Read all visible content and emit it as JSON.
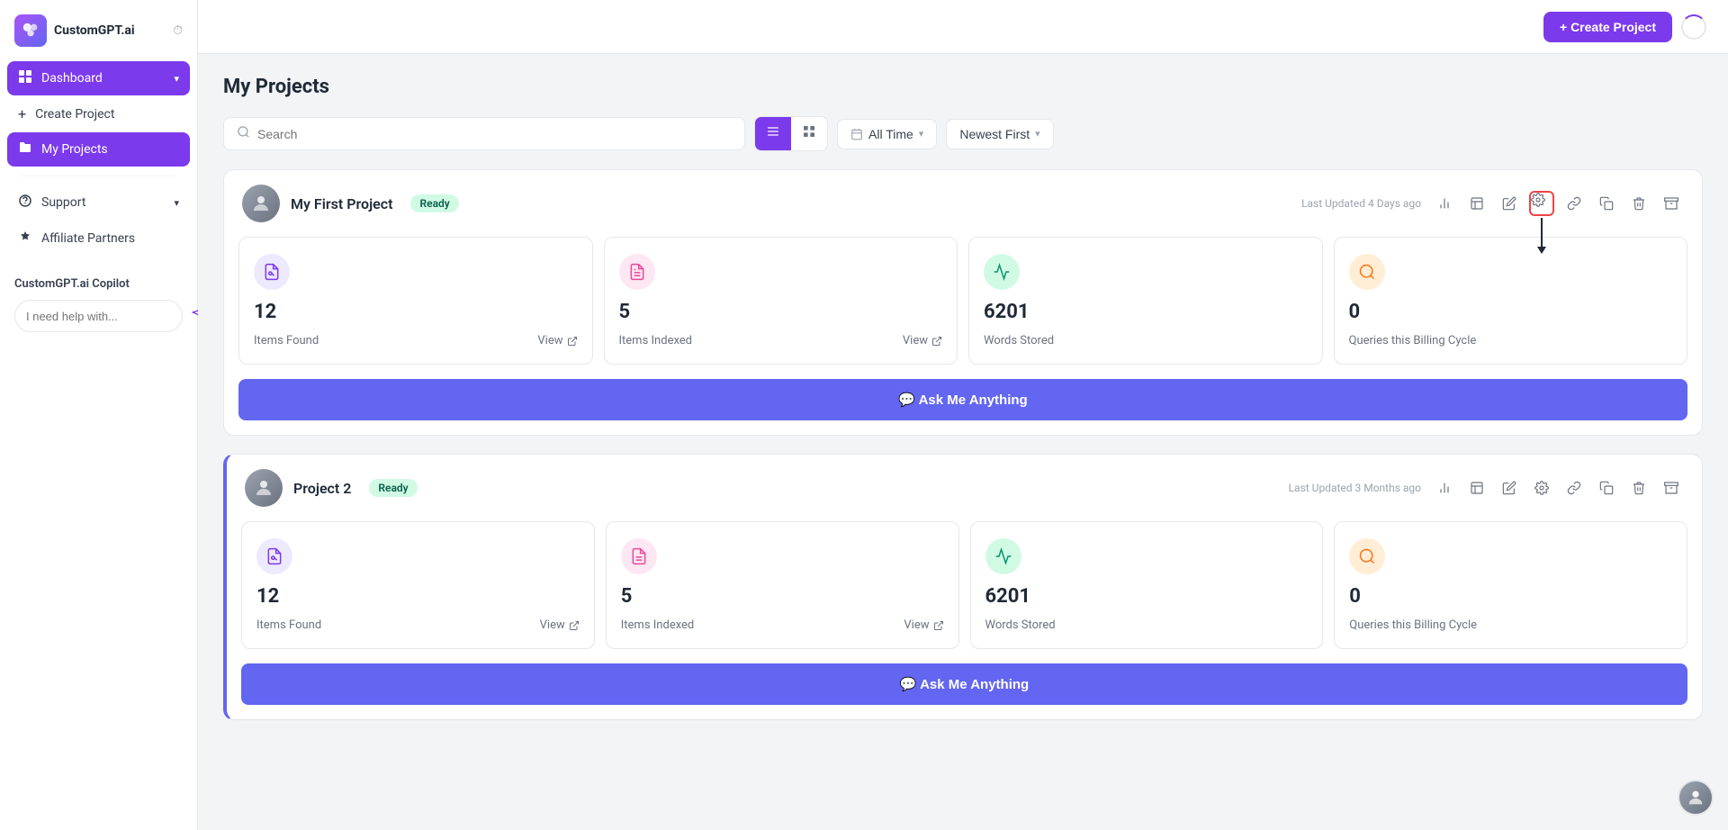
{
  "brand": {
    "logo_text": "CustomGPT.ai",
    "logo_icon": "🤖"
  },
  "sidebar": {
    "items": [
      {
        "id": "dashboard",
        "label": "Dashboard",
        "icon": "⊞",
        "active": true,
        "has_chevron": true
      },
      {
        "id": "create-project",
        "label": "Create Project",
        "icon": "+",
        "active": false
      },
      {
        "id": "my-projects",
        "label": "My Projects",
        "icon": "📁",
        "active": true
      },
      {
        "id": "support",
        "label": "Support",
        "icon": "🔔",
        "active": false,
        "has_chevron": true
      },
      {
        "id": "affiliate",
        "label": "Affiliate Partners",
        "icon": "✦",
        "active": false
      }
    ],
    "copilot": {
      "title": "CustomGPT.ai Copilot",
      "placeholder": "I need help with..."
    }
  },
  "topbar": {
    "create_button": "+ Create Project"
  },
  "page": {
    "title": "My Projects",
    "search_placeholder": "Search"
  },
  "toolbar": {
    "time_filter": "All Time",
    "sort_filter": "Newest First"
  },
  "projects": [
    {
      "id": "project-1",
      "name": "My First Project",
      "status": "Ready",
      "last_updated": "Last Updated 4 Days ago",
      "stats": [
        {
          "id": "items-found",
          "number": "12",
          "label": "Items Found",
          "has_view": true,
          "icon_class": "purple",
          "icon": "📄"
        },
        {
          "id": "items-indexed",
          "number": "5",
          "label": "Items Indexed",
          "has_view": true,
          "icon_class": "pink",
          "icon": "📋"
        },
        {
          "id": "words-stored",
          "number": "6201",
          "label": "Words Stored",
          "has_view": false,
          "icon_class": "green",
          "icon": "📈"
        },
        {
          "id": "queries",
          "number": "0",
          "label": "Queries this Billing Cycle",
          "has_view": false,
          "icon_class": "orange",
          "icon": "🔍"
        }
      ],
      "ask_button": "💬 Ask Me Anything",
      "settings_highlighted": true
    },
    {
      "id": "project-2",
      "name": "Project 2",
      "status": "Ready",
      "last_updated": "Last Updated 3 Months ago",
      "stats": [
        {
          "id": "items-found",
          "number": "12",
          "label": "Items Found",
          "has_view": true,
          "icon_class": "purple",
          "icon": "📄"
        },
        {
          "id": "items-indexed",
          "number": "5",
          "label": "Items Indexed",
          "has_view": true,
          "icon_class": "pink",
          "icon": "📋"
        },
        {
          "id": "words-stored",
          "number": "6201",
          "label": "Words Stored",
          "has_view": false,
          "icon_class": "green",
          "icon": "📈"
        },
        {
          "id": "queries",
          "number": "0",
          "label": "Queries this Billing Cycle",
          "has_view": false,
          "icon_class": "orange",
          "icon": "🔍"
        }
      ],
      "ask_button": "💬 Ask Me Anything",
      "settings_highlighted": false
    }
  ],
  "action_icons": {
    "chart": "📊",
    "grid": "⊞",
    "link": "🔗",
    "settings": "⚙",
    "copy_link": "🔗",
    "copy": "📋",
    "delete": "🗑",
    "archive": "🗄"
  },
  "view_icons": {
    "list": "☰",
    "grid": "⊞"
  },
  "stat_view_label": "View",
  "stat_view_icon": "↗"
}
